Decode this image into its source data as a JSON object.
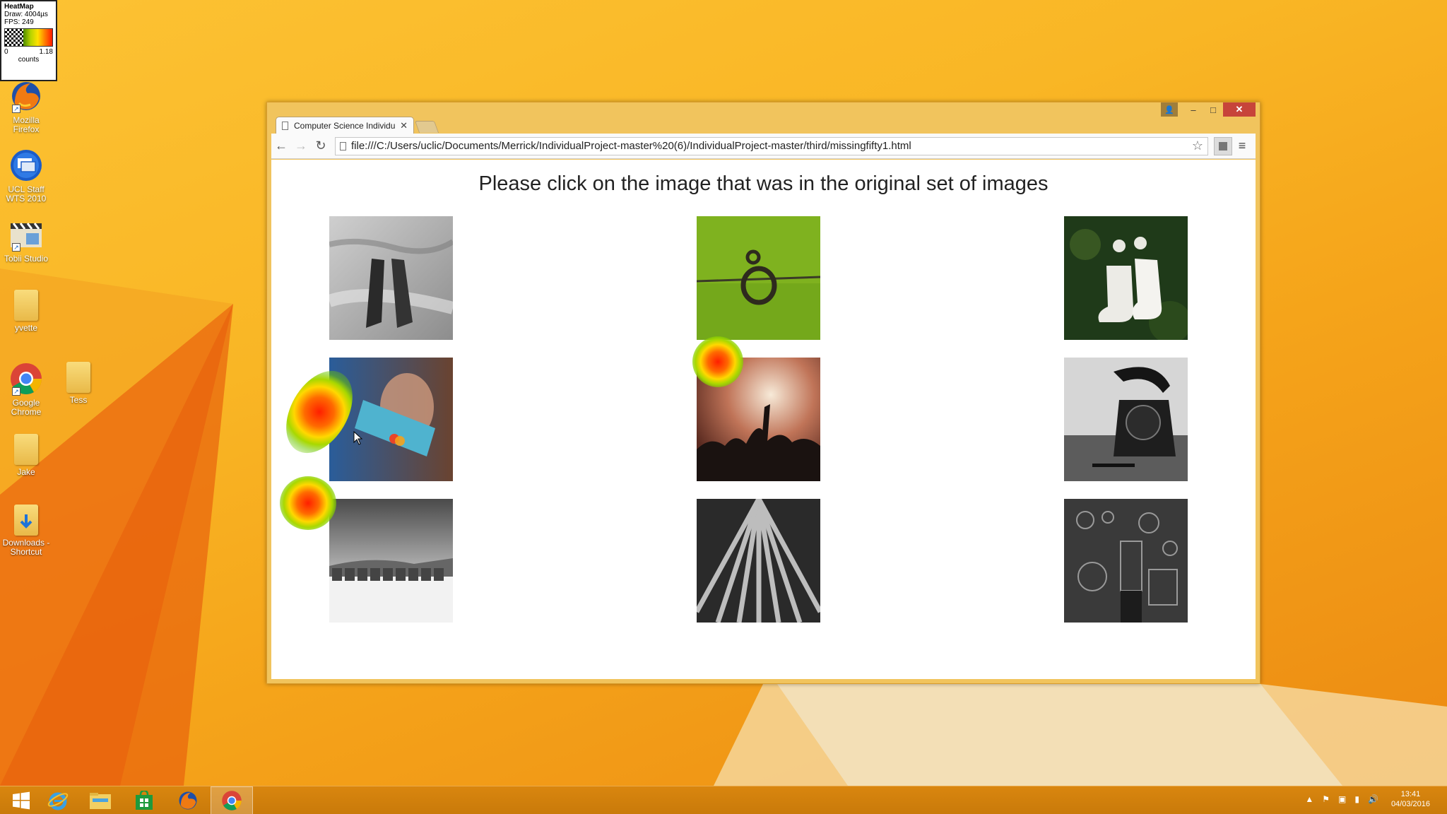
{
  "heatmap_widget": {
    "title": "HeatMap",
    "draw_time": "Draw: 4004µs",
    "fps": "FPS: 249",
    "scale_min": "0",
    "scale_max": "1.18",
    "unit": "counts"
  },
  "desktop_icons": [
    {
      "label_line1": "Mozilla",
      "label_line2": "Firefox",
      "icon": "firefox-icon"
    },
    {
      "label_line1": "UCL Staff",
      "label_line2": "WTS 2010",
      "icon": "remote-desktop-icon"
    },
    {
      "label_line1": "Tobii Studio",
      "label_line2": "",
      "icon": "clapperboard-icon"
    },
    {
      "label_line1": "yvette",
      "label_line2": "",
      "icon": "folder-icon"
    },
    {
      "label_line1": "Google",
      "label_line2": "Chrome",
      "icon": "chrome-icon"
    },
    {
      "label_line1": "Tess",
      "label_line2": "",
      "icon": "folder-icon"
    },
    {
      "label_line1": "Jake",
      "label_line2": "",
      "icon": "folder-icon"
    },
    {
      "label_line1": "Downloads -",
      "label_line2": "Shortcut",
      "icon": "downloads-folder-icon"
    }
  ],
  "browser": {
    "tab_title": "Computer Science Individu",
    "url": "file:///C:/Users/uclic/Documents/Merrick/IndividualProject-master%20(6)/IndividualProject-master/third/missingfifty1.html",
    "window_controls": {
      "minimize": "–",
      "maximize": "□",
      "close": "✕"
    }
  },
  "page": {
    "heading": "Please click on the image that was in the original set of images",
    "images": [
      {
        "subject": "legs in sand dunes",
        "tone": "grayscale"
      },
      {
        "subject": "barbed wire knot on green",
        "tone": "color"
      },
      {
        "subject": "white socks on grass",
        "tone": "color"
      },
      {
        "subject": "hand holding credit card",
        "tone": "color"
      },
      {
        "subject": "concert crowd",
        "tone": "color"
      },
      {
        "subject": "rotary telephone",
        "tone": "grayscale"
      },
      {
        "subject": "beach huts",
        "tone": "grayscale"
      },
      {
        "subject": "crop field rows",
        "tone": "grayscale"
      },
      {
        "subject": "machinery room",
        "tone": "grayscale"
      }
    ]
  },
  "taskbar": {
    "apps": [
      "windows-start-icon",
      "internet-explorer-icon",
      "file-explorer-icon",
      "store-icon",
      "firefox-icon",
      "chrome-icon"
    ],
    "active_app": "chrome-icon",
    "time": "13:41",
    "date": "04/03/2016"
  },
  "colors": {
    "heat_high": "#ff1f00",
    "heat_mid": "#ffd800",
    "heat_low": "#6ec800",
    "window_frame": "#f1c45d",
    "close_button": "#c7443a"
  }
}
